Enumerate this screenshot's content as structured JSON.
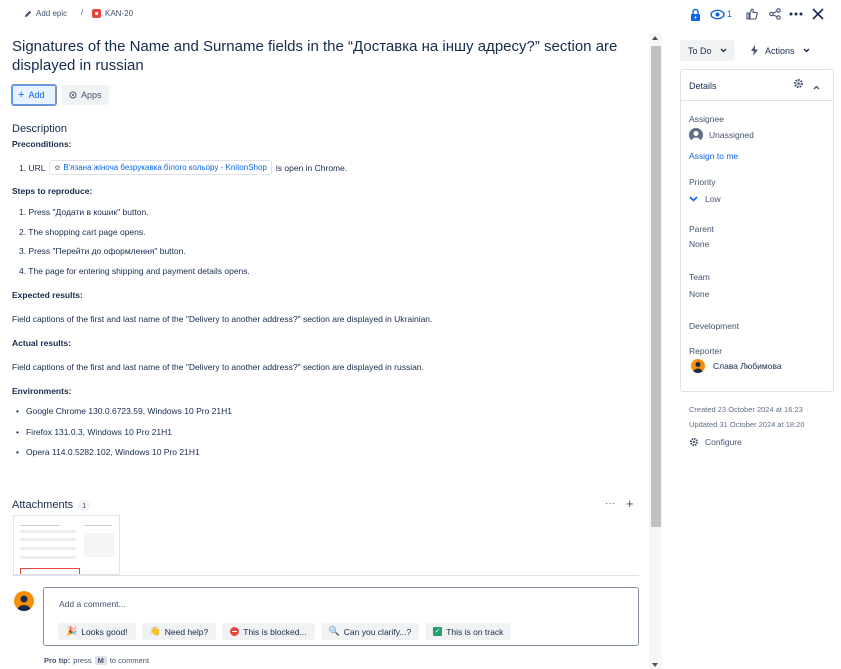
{
  "breadcrumb": {
    "add_epic": "Add epic",
    "separator": "/",
    "issue_key": "KAN-20"
  },
  "topbar": {
    "watch_count": "1"
  },
  "issue": {
    "title": "Signatures of the Name and Surname fields in the “Доставка на іншу адресу?” section are displayed in russian",
    "add_label": "Add",
    "apps_label": "Apps"
  },
  "description": {
    "heading": "Description",
    "preconditions": "Preconditions:",
    "pre_item_prefix": "1. URL",
    "pre_link": "В'язана жіноча безрукавка білого кольору - KnitonShop",
    "pre_suffix": "is open in Chrome.",
    "steps_heading": "Steps to reproduce:",
    "steps": [
      "1. Press \"Додати в кошик\" button.",
      "2. The shopping cart page opens.",
      "3. Press \"Перейти до оформлення\" button.",
      "4. The page for entering shipping and payment details opens."
    ],
    "expected_heading": "Expected results:",
    "expected_text": "Field captions of the first and last name of the \"Delivery to another address?\" section are displayed in Ukrainian.",
    "actual_heading": "Actual results:",
    "actual_text": "Field captions of the first and last name of the \"Delivery to another address?\" section are displayed in russian.",
    "env_heading": "Environments:",
    "environments": [
      "Google Chrome 130.0.6723.59, Windows 10 Pro 21H1",
      "Firefox 131.0.3, Windows 10 Pro 21H1",
      "Opera 114.0.5282.102, Windows 10 Pro 21H1"
    ]
  },
  "attachments": {
    "heading": "Attachments",
    "count": "1",
    "more": "···",
    "add": "+"
  },
  "comment": {
    "placeholder": "Add a comment...",
    "quick": [
      "Looks good!",
      "Need help?",
      "This is blocked...",
      "Can you clarify...?",
      "This is on track"
    ],
    "protip_label": "Pro tip:",
    "protip_press": "press",
    "protip_key": "M",
    "protip_suffix": "to comment"
  },
  "sidebar": {
    "status": "To Do",
    "actions": "Actions",
    "details_title": "Details",
    "assignee_label": "Assignee",
    "assignee_value": "Unassigned",
    "assign_to_me": "Assign to me",
    "priority_label": "Priority",
    "priority_value": "Low",
    "parent_label": "Parent",
    "parent_value": "None",
    "team_label": "Team",
    "team_value": "None",
    "development_label": "Development",
    "reporter_label": "Reporter",
    "reporter_value": "Слава Любимова",
    "created": "Created 23 October 2024 at 16:23",
    "updated": "Updated 31 October 2024 at 18:20",
    "configure": "Configure"
  },
  "colors": {
    "accent": "#0c66e4",
    "border": "#dfe1e6",
    "text": "#172b4d",
    "muted": "#44546f"
  }
}
